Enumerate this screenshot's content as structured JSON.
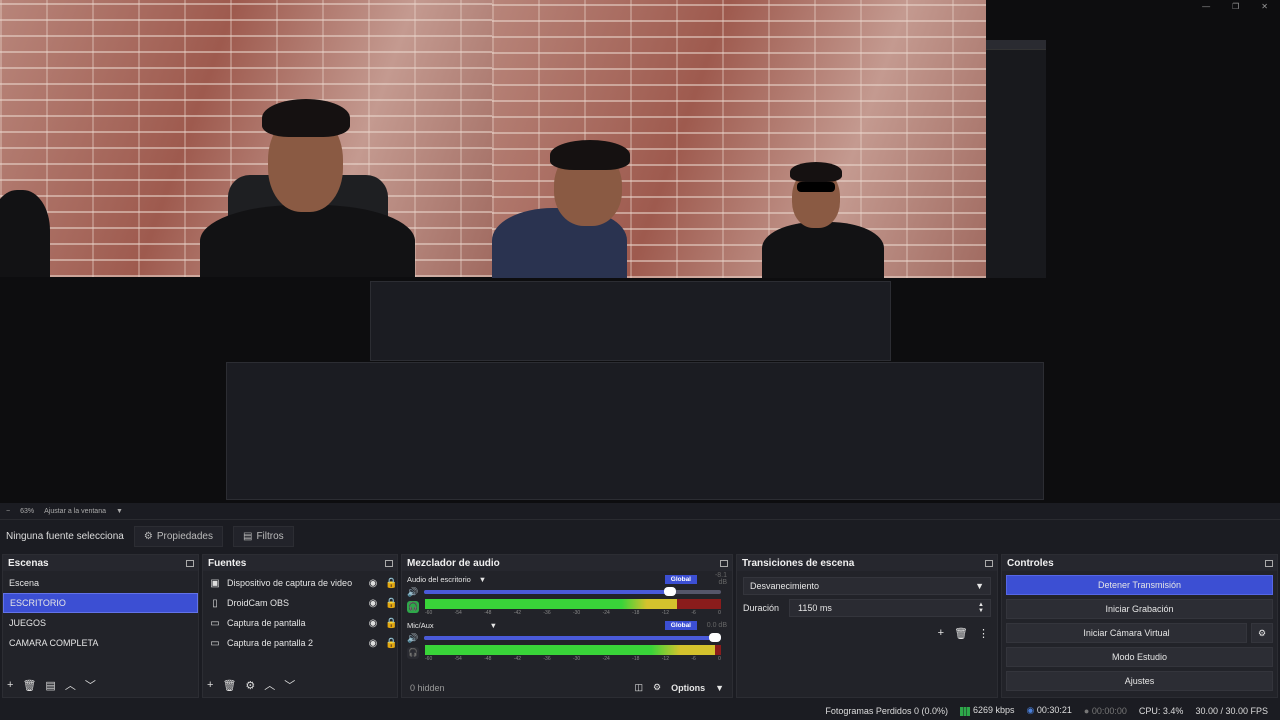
{
  "window_controls": [
    "—",
    "❐",
    "✕"
  ],
  "zoom": {
    "level": "63%",
    "mode": "Ajustar a la ventana"
  },
  "source_bar": {
    "no_selection": "Ninguna fuente selecciona",
    "properties": "Propiedades",
    "filters": "Filtros"
  },
  "scenes": {
    "title": "Escenas",
    "items": [
      "Escena",
      "ESCRITORIO",
      "JUEGOS",
      "CAMARA COMPLETA"
    ],
    "selected_index": 1
  },
  "sources": {
    "title": "Fuentes",
    "items": [
      {
        "name": "Dispositivo de captura de video",
        "icon": "camera-icon"
      },
      {
        "name": "DroidCam OBS",
        "icon": "document-icon"
      },
      {
        "name": "Captura de pantalla",
        "icon": "monitor-icon"
      },
      {
        "name": "Captura de pantalla 2",
        "icon": "monitor-icon"
      }
    ]
  },
  "mixer": {
    "title": "Mezclador de audio",
    "channels": [
      {
        "name": "Audio del escritorio",
        "badge": "Global",
        "db": "-8.1 dB",
        "volume": 0.85,
        "level": 0.85
      },
      {
        "name": "Mic/Aux",
        "badge": "Global",
        "db": "0.0 dB",
        "volume": 1.0,
        "level": 0.98
      }
    ],
    "ticks": [
      "-60",
      "-54",
      "-48",
      "-42",
      "-36",
      "-30",
      "-24",
      "-18",
      "-12",
      "-6",
      "0"
    ],
    "hidden": "0 hidden",
    "options": "Options"
  },
  "transitions": {
    "title": "Transiciones de escena",
    "selected": "Desvanecimiento",
    "duration_label": "Duración",
    "duration_value": "1150 ms"
  },
  "controls": {
    "title": "Controles",
    "buttons": [
      "Detener Transmisión",
      "Iniciar Grabación",
      "Iniciar Cámara Virtual",
      "Modo Estudio",
      "Ajustes"
    ]
  },
  "status": {
    "dropped": "Fotogramas Perdidos 0 (0.0%)",
    "kbps": "6269 kbps",
    "stream_time": "00:30:21",
    "rec_time": "00:00:00",
    "cpu": "CPU: 3.4%",
    "fps": "30.00 / 30.00 FPS"
  },
  "colors": {
    "accent": "#3c4fd3",
    "meter_green": "#39d439",
    "meter_yellow": "#d4c22d",
    "meter_red": "#8a1c1c"
  }
}
